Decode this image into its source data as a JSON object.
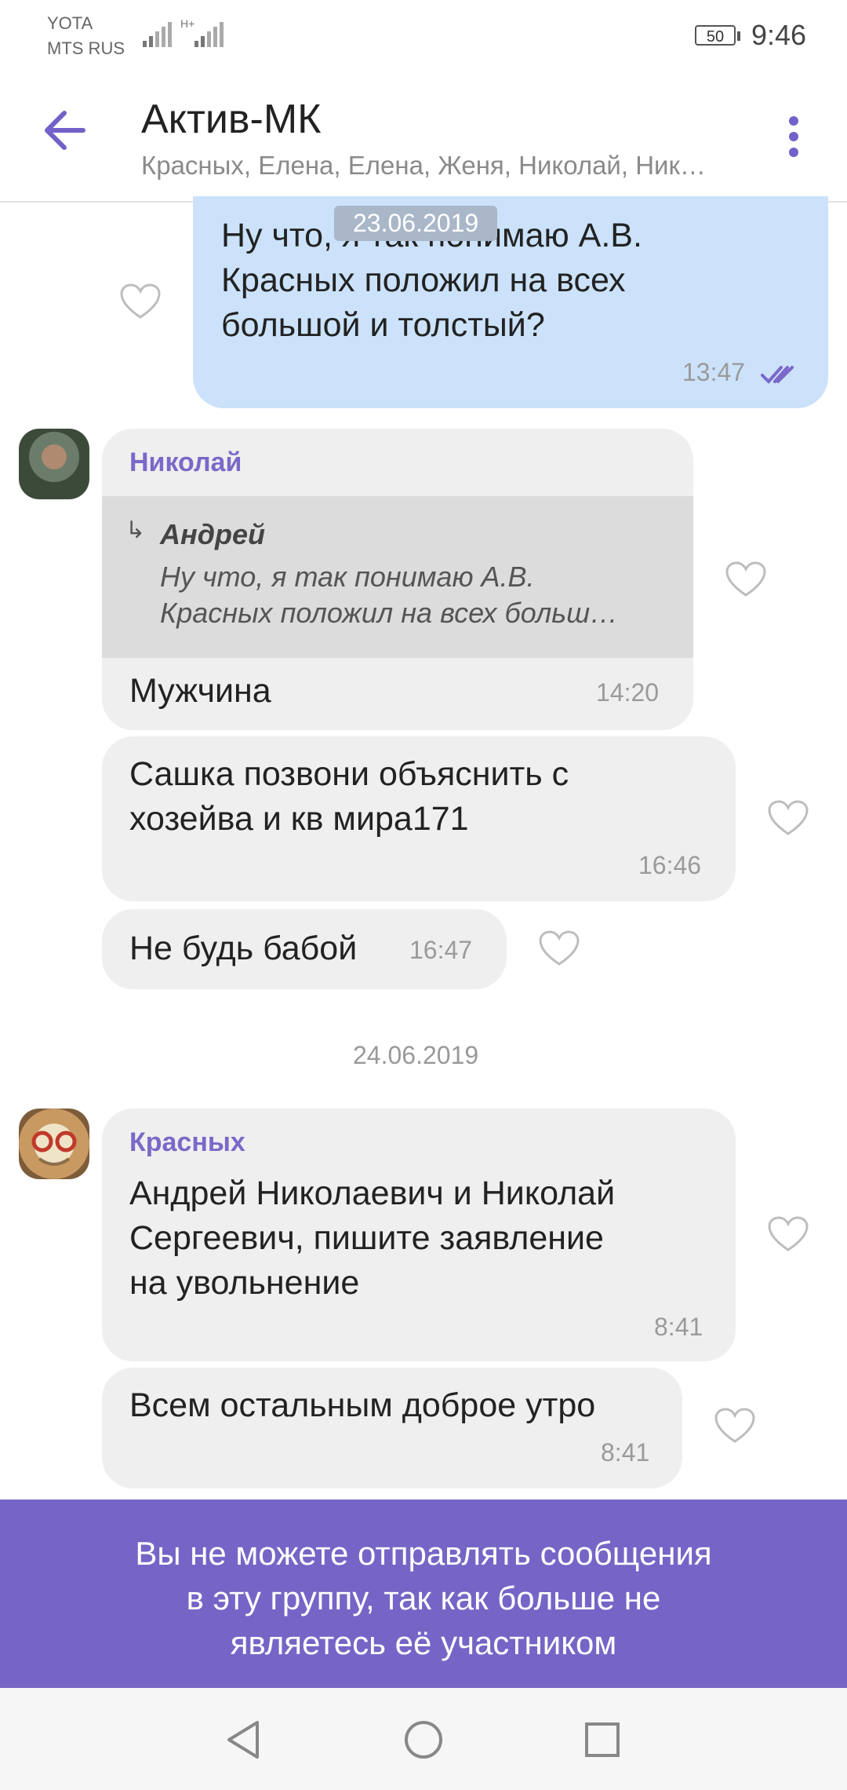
{
  "status_bar": {
    "carrier_1": "YOTA",
    "carrier_2": "MTS RUS",
    "signal_2_label": "H+",
    "battery": "50",
    "time": "9:46"
  },
  "header": {
    "title": "Актив-МК",
    "members": "Красных, Елена, Елена, Женя, Николай, Ник…",
    "accent_color": "#7360c9"
  },
  "messages": {
    "m1": {
      "date_chip": "23.06.2019",
      "text_lines": [
        "Ну что, я так понимаю А.В.",
        "Красных положил на всех",
        "большой и толстый?"
      ],
      "time": "13:47"
    },
    "m2": {
      "sender": "Николай",
      "reply_author": "Андрей",
      "reply_lines": [
        "Ну что, я так понимаю А.В.",
        "Красных положил на всех больш…"
      ],
      "text": "Мужчина",
      "time": "14:20"
    },
    "m3": {
      "text_lines": [
        "Сашка позвони объяснить с",
        "хозейва и кв мира171"
      ],
      "time": "16:46"
    },
    "m4": {
      "text": "Не будь бабой",
      "time": "16:47"
    },
    "date_separator": "24.06.2019",
    "m5": {
      "sender": "Красных",
      "text_lines": [
        "Андрей Николаевич и Николай",
        "Сергеевич, пишите заявление",
        "на увольнение"
      ],
      "time": "8:41"
    },
    "m6": {
      "text": "Всем остальным доброе утро",
      "time": "8:41"
    }
  },
  "banner": {
    "lines": [
      "Вы не можете отправлять сообщения",
      "в эту группу, так как больше не",
      "являетесь её участником"
    ],
    "color": "#7665c6"
  },
  "nav_bar": {
    "icons": [
      "back-triangle-icon",
      "home-circle-icon",
      "recents-square-icon"
    ]
  }
}
